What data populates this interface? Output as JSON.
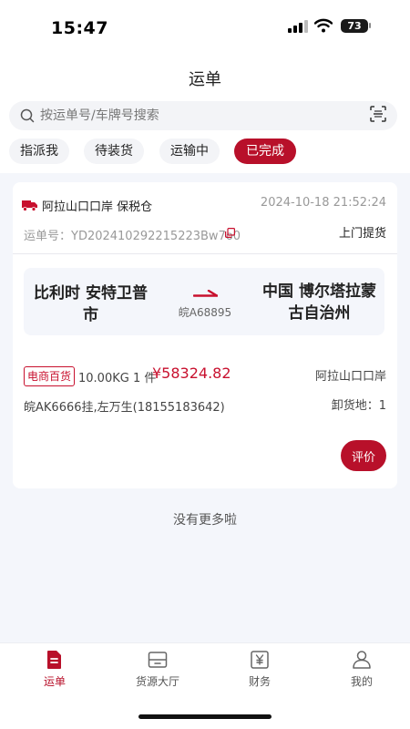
{
  "status_bar": {
    "time": "15:47",
    "battery": "73"
  },
  "header": {
    "title": "运单"
  },
  "search": {
    "placeholder": "按运单号/车牌号搜索"
  },
  "tabs": [
    {
      "label": "指派我",
      "active": false
    },
    {
      "label": "待装货",
      "active": false
    },
    {
      "label": "运输中",
      "active": false
    },
    {
      "label": "已完成",
      "active": true
    }
  ],
  "order": {
    "warehouse": "阿拉山口口岸 保税仓",
    "time": "2024-10-18 21:52:24",
    "order_no": "运单号：YD202410292215223Bw7o0",
    "pickup_type": "上门提货",
    "route_from": "比利时 安特卫普市",
    "route_to": "中国 博尔塔拉蒙古自治州",
    "plate": "皖A68895",
    "category": "电商百货",
    "weight_qty": "10.00KG 1 件",
    "price": "¥58324.82",
    "port": "阿拉山口口岸",
    "driver": "皖AK6666挂,左万生(18155183642)",
    "unload": "卸货地：1",
    "evaluate_label": "评价"
  },
  "list_end": "没有更多啦",
  "bottom_nav": [
    {
      "label": "运单",
      "icon": "waybill-icon",
      "active": true
    },
    {
      "label": "货源大厅",
      "icon": "cargo-hall-icon",
      "active": false
    },
    {
      "label": "财务",
      "icon": "finance-icon",
      "active": false
    },
    {
      "label": "我的",
      "icon": "profile-icon",
      "active": false
    }
  ],
  "colors": {
    "brand": "#b8102a",
    "price": "#c8102e",
    "background": "#f4f6fb"
  }
}
